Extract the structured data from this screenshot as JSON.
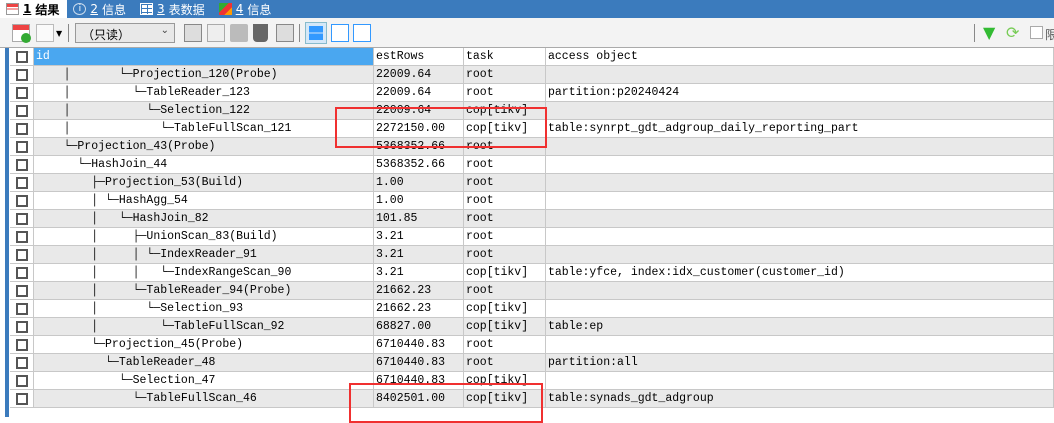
{
  "tabs": [
    {
      "num": "1",
      "label": "结果",
      "icon": "grid-result-icon"
    },
    {
      "num": "2",
      "label": "信息",
      "icon": "info-icon"
    },
    {
      "num": "3",
      "label": "表数据",
      "icon": "table-icon"
    },
    {
      "num": "4",
      "label": "信息",
      "icon": "shapes-icon"
    }
  ],
  "toolbar": {
    "readonly": "（只读）",
    "limit_label": "限"
  },
  "columns": [
    "id",
    "estRows",
    "task",
    "access object"
  ],
  "rows": [
    {
      "id": "    │       └─Projection_120(Probe)",
      "estRows": "22009.64",
      "task": "root",
      "access": ""
    },
    {
      "id": "    │         └─TableReader_123",
      "estRows": "22009.64",
      "task": "root",
      "access": "partition:p20240424"
    },
    {
      "id": "    │           └─Selection_122",
      "estRows": "22009.64",
      "task": "cop[tikv]",
      "access": ""
    },
    {
      "id": "    │             └─TableFullScan_121",
      "estRows": "2272150.00",
      "task": "cop[tikv]",
      "access": "table:synrpt_gdt_adgroup_daily_reporting_part"
    },
    {
      "id": "    └─Projection_43(Probe)",
      "estRows": "5368352.66",
      "task": "root",
      "access": ""
    },
    {
      "id": "      └─HashJoin_44",
      "estRows": "5368352.66",
      "task": "root",
      "access": ""
    },
    {
      "id": "        ├─Projection_53(Build)",
      "estRows": "1.00",
      "task": "root",
      "access": ""
    },
    {
      "id": "        │ └─HashAgg_54",
      "estRows": "1.00",
      "task": "root",
      "access": ""
    },
    {
      "id": "        │   └─HashJoin_82",
      "estRows": "101.85",
      "task": "root",
      "access": ""
    },
    {
      "id": "        │     ├─UnionScan_83(Build)",
      "estRows": "3.21",
      "task": "root",
      "access": ""
    },
    {
      "id": "        │     │ └─IndexReader_91",
      "estRows": "3.21",
      "task": "root",
      "access": ""
    },
    {
      "id": "        │     │   └─IndexRangeScan_90",
      "estRows": "3.21",
      "task": "cop[tikv]",
      "access": "table:yfce, index:idx_customer(customer_id)"
    },
    {
      "id": "        │     └─TableReader_94(Probe)",
      "estRows": "21662.23",
      "task": "root",
      "access": ""
    },
    {
      "id": "        │       └─Selection_93",
      "estRows": "21662.23",
      "task": "cop[tikv]",
      "access": ""
    },
    {
      "id": "        │         └─TableFullScan_92",
      "estRows": "68827.00",
      "task": "cop[tikv]",
      "access": "table:ep"
    },
    {
      "id": "        └─Projection_45(Probe)",
      "estRows": "6710440.83",
      "task": "root",
      "access": ""
    },
    {
      "id": "          └─TableReader_48",
      "estRows": "6710440.83",
      "task": "root",
      "access": "partition:all"
    },
    {
      "id": "            └─Selection_47",
      "estRows": "6710440.83",
      "task": "cop[tikv]",
      "access": ""
    },
    {
      "id": "              └─TableFullScan_46",
      "estRows": "8402501.00",
      "task": "cop[tikv]",
      "access": "table:synads_gdt_adgroup"
    }
  ],
  "colors": {
    "accent": "#3b7bbd",
    "header_selected": "#4aa7f0",
    "highlight": "#f03030"
  }
}
